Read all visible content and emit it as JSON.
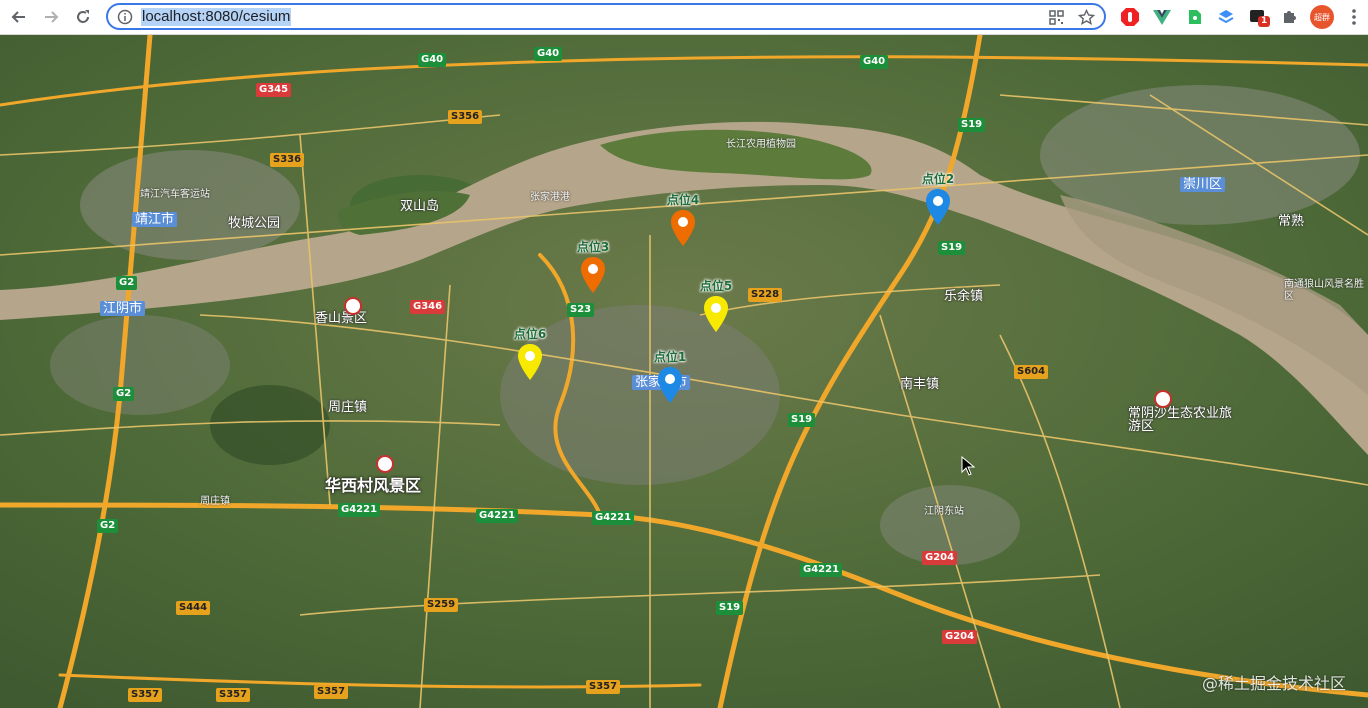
{
  "browser": {
    "url": "localhost:8080/cesium",
    "profile_label": "超群",
    "extension_badge": "1"
  },
  "map": {
    "markers": [
      {
        "label": "点位1",
        "color": "#1e88e5"
      },
      {
        "label": "点位2",
        "color": "#1e88e5"
      },
      {
        "label": "点位3",
        "color": "#ef6c00"
      },
      {
        "label": "点位4",
        "color": "#ef6c00"
      },
      {
        "label": "点位5",
        "color": "#f7ea00"
      },
      {
        "label": "点位6",
        "color": "#f7ea00"
      }
    ],
    "places": {
      "jiangyin": "江阴市",
      "jingjiang": "靖江市",
      "zhangjiagang": "张家港市",
      "xiangshan": "香山景区",
      "huaxicun": "华西村风景区",
      "zhouzhuang": "周庄镇",
      "nanfeng": "南丰镇",
      "lefeng": "乐余镇",
      "changyin": "常阴沙生态农业旅游区",
      "mucheng": "牧城公园",
      "shuangshan": "双山岛",
      "zhangjiagang_port": "张家港港",
      "changshu": "常熟",
      "nantong_jq": "南通狼山风景名胜区",
      "tongzhou": "崇川区",
      "jiangyin_east": "江阴东站",
      "garden": "长江农用植物园",
      "jingjiang_station": "靖江汽车客运站",
      "taizhou": "周庄镇"
    },
    "shields": [
      "G2",
      "G2",
      "G2",
      "G40",
      "G40",
      "G40",
      "G345",
      "G346",
      "G4221",
      "G4221",
      "G4221",
      "G4221",
      "G204",
      "G204",
      "S19",
      "S19",
      "S19",
      "S19",
      "S228",
      "S23",
      "S604",
      "S336",
      "S356",
      "S357",
      "S357",
      "S357",
      "S357",
      "S259",
      "S444"
    ],
    "watermark": "@稀土掘金技术社区",
    "colors": {
      "water": "#b9a88c",
      "road": "#f0a72a",
      "land": "#4f6b3a"
    }
  }
}
